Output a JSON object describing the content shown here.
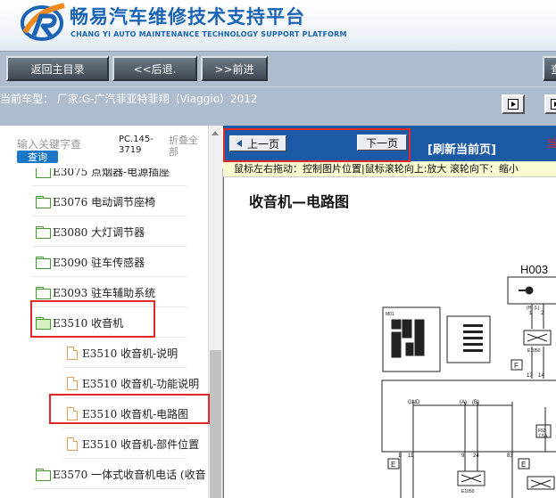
{
  "header": {
    "title": "畅易汽车维修技术支持平台",
    "subtitle": "CHANG YI AUTO MAINTENANCE TECHNOLOGY SUPPORT PLATFORM"
  },
  "toolbar": {
    "home_label": "返回主目录",
    "back_label": "<<后退.",
    "forward_label": ">>前进",
    "edge_label": "查"
  },
  "vehicle": {
    "label": "当前车型：  厂家:G-广汽菲亚特菲翔（Viaggio）2012"
  },
  "left_panel": {
    "search_hint": "输入关键字查",
    "search_button": "查询",
    "pc_code": "PC.145-3719",
    "collapse_label": "折叠全部",
    "tree": [
      {
        "label": "E3075 点烟器-电源插座",
        "type": "folder",
        "level": 1,
        "partial": true
      },
      {
        "label": "E3076 电动调节座椅",
        "type": "folder",
        "level": 1
      },
      {
        "label": "E3080 大灯调节器",
        "type": "folder",
        "level": 1
      },
      {
        "label": "E3090 驻车传感器",
        "type": "folder",
        "level": 1
      },
      {
        "label": "E3093 驻车辅助系统",
        "type": "folder",
        "level": 1
      },
      {
        "label": "E3510 收音机",
        "type": "folder-open",
        "level": 1
      },
      {
        "label": "E3510 收音机-说明",
        "type": "doc",
        "level": 2
      },
      {
        "label": "E3510 收音机-功能说明",
        "type": "doc",
        "level": 2
      },
      {
        "label": "E3510 收音机-电路图",
        "type": "doc",
        "level": 2
      },
      {
        "label": "E3510 收音机-部件位置",
        "type": "doc",
        "level": 2
      },
      {
        "label": "E3570 一体式收音机电话 (收音",
        "type": "folder",
        "level": 1
      }
    ]
  },
  "content": {
    "prev_label": "上一页",
    "next_label": "下一页",
    "refresh_label": "[刷新当前页]",
    "edge_label": "当",
    "hint": "鼠标左右拖动：控制图片位置|鼠标滚轮向上:放大  滚轮向下：缩小",
    "diagram_title": "收音机—电路图",
    "diagram_labels": {
      "h003": "H003",
      "m01": "M01",
      "gnd": "GND",
      "a": "(A)",
      "b": "(B)",
      "e1050": "E1050",
      "e1050b": "E1050",
      "f": "F",
      "f53": "F53",
      "amp": "7.5A",
      "e": "E",
      "n1": "1",
      "n2": "2",
      "n13": "13",
      "n14": "14",
      "n9": "9",
      "n24": "24",
      "n83": "83",
      "n1b": "1",
      "n11": "11",
      "hl": "(H)  (L)"
    }
  },
  "colors": {
    "brand_blue": "#1a63b5",
    "toolbar_bg": "#aebdcd",
    "nav_blue": "#1c5aa6",
    "highlight_red": "#e02828",
    "folder_green": "#3c9a2a",
    "doc_orange": "#e0a05a"
  }
}
